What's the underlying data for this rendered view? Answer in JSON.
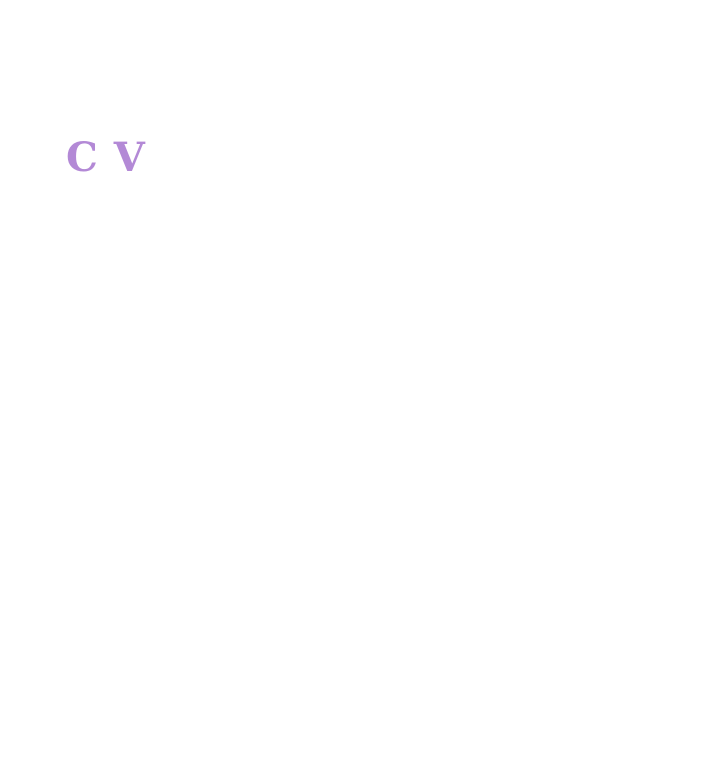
{
  "document": {
    "heading": "C V",
    "heading_color": "#b389d6",
    "background_color": "#ffffff"
  }
}
